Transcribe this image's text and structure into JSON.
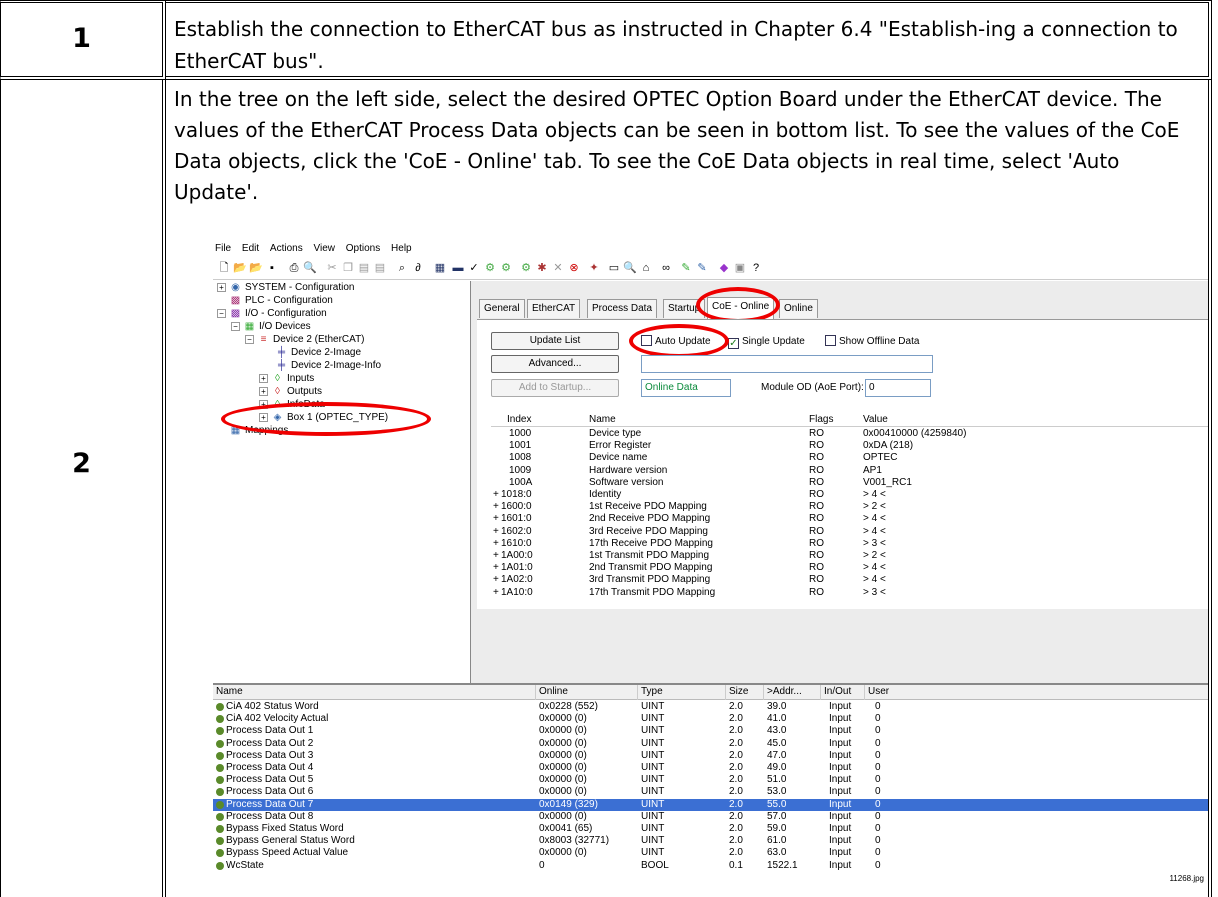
{
  "steps": [
    {
      "number": "1",
      "text": "Establish the connection to EtherCAT bus as instructed in Chapter 6.4 \"Establish-ing a connection to EtherCAT bus\"."
    },
    {
      "number": "2",
      "text": "In the tree on the left side, select the desired OPTEC Option Board under the EtherCAT device. The values of the EtherCAT Process Data objects can be seen in bottom list. To see the values of the CoE Data objects, click the 'CoE - Online' tab. To see the CoE Data objects in real time, select 'Auto Update'."
    }
  ],
  "screenshot": {
    "menu": [
      "File",
      "Edit",
      "Actions",
      "View",
      "Options",
      "Help"
    ],
    "tree": [
      {
        "label": "SYSTEM - Configuration"
      },
      {
        "label": "PLC - Configuration"
      },
      {
        "label": "I/O - Configuration"
      },
      {
        "label": "I/O Devices"
      },
      {
        "label": "Device 2 (EtherCAT)"
      },
      {
        "label": "Device 2-Image"
      },
      {
        "label": "Device 2-Image-Info"
      },
      {
        "label": "Inputs"
      },
      {
        "label": "Outputs"
      },
      {
        "label": "InfoData"
      },
      {
        "label": "Box 1 (OPTEC_TYPE)"
      },
      {
        "label": "Mappings"
      }
    ],
    "tabs": [
      "General",
      "EtherCAT",
      "Process Data",
      "Startup",
      "CoE - Online",
      "Online"
    ],
    "buttons": {
      "update_list": "Update List",
      "advanced": "Advanced...",
      "add_to_startup": "Add to Startup..."
    },
    "checks": {
      "auto_update": "Auto Update",
      "single_update": "Single Update",
      "show_offline": "Show Offline Data"
    },
    "online_data": "Online Data",
    "module_od_label": "Module OD (AoE Port):",
    "module_od_value": "0",
    "coe_headers": [
      "Index",
      "Name",
      "Flags",
      "Value"
    ],
    "coe_rows": [
      {
        "index": "1000",
        "name": "Device type",
        "flags": "RO",
        "value": "0x00410000 (4259840)"
      },
      {
        "index": "1001",
        "name": "Error Register",
        "flags": "RO",
        "value": "0xDA (218)"
      },
      {
        "index": "1008",
        "name": "Device name",
        "flags": "RO",
        "value": "OPTEC"
      },
      {
        "index": "1009",
        "name": "Hardware version",
        "flags": "RO",
        "value": "AP1"
      },
      {
        "index": "100A",
        "name": "Software version",
        "flags": "RO",
        "value": "V001_RC1"
      },
      {
        "index": "1018:0",
        "name": "Identity",
        "flags": "RO",
        "value": "> 4 <"
      },
      {
        "index": "1600:0",
        "name": "1st Receive PDO Mapping",
        "flags": "RO",
        "value": "> 2 <"
      },
      {
        "index": "1601:0",
        "name": "2nd Receive PDO Mapping",
        "flags": "RO",
        "value": "> 4 <"
      },
      {
        "index": "1602:0",
        "name": "3rd Receive PDO Mapping",
        "flags": "RO",
        "value": "> 4 <"
      },
      {
        "index": "1610:0",
        "name": "17th Receive PDO Mapping",
        "flags": "RO",
        "value": "> 3 <"
      },
      {
        "index": "1A00:0",
        "name": "1st Transmit PDO Mapping",
        "flags": "RO",
        "value": "> 2 <"
      },
      {
        "index": "1A01:0",
        "name": "2nd Transmit PDO Mapping",
        "flags": "RO",
        "value": "> 4 <"
      },
      {
        "index": "1A02:0",
        "name": "3rd Transmit PDO Mapping",
        "flags": "RO",
        "value": "> 4 <"
      },
      {
        "index": "1A10:0",
        "name": "17th Transmit PDO Mapping",
        "flags": "RO",
        "value": "> 3 <"
      }
    ],
    "pd_headers": [
      "Name",
      "Online",
      "Type",
      "Size",
      ">Addr...",
      "In/Out",
      "User"
    ],
    "pd_rows": [
      {
        "name": "CiA 402 Status Word",
        "online": "0x0228 (552)",
        "type": "UINT",
        "size": "2.0",
        "addr": "39.0",
        "io": "Input",
        "user": "0"
      },
      {
        "name": "CiA 402 Velocity Actual",
        "online": "0x0000 (0)",
        "type": "UINT",
        "size": "2.0",
        "addr": "41.0",
        "io": "Input",
        "user": "0"
      },
      {
        "name": "Process Data Out 1",
        "online": "0x0000 (0)",
        "type": "UINT",
        "size": "2.0",
        "addr": "43.0",
        "io": "Input",
        "user": "0"
      },
      {
        "name": "Process Data Out 2",
        "online": "0x0000 (0)",
        "type": "UINT",
        "size": "2.0",
        "addr": "45.0",
        "io": "Input",
        "user": "0"
      },
      {
        "name": "Process Data Out 3",
        "online": "0x0000 (0)",
        "type": "UINT",
        "size": "2.0",
        "addr": "47.0",
        "io": "Input",
        "user": "0"
      },
      {
        "name": "Process Data Out 4",
        "online": "0x0000 (0)",
        "type": "UINT",
        "size": "2.0",
        "addr": "49.0",
        "io": "Input",
        "user": "0"
      },
      {
        "name": "Process Data Out 5",
        "online": "0x0000 (0)",
        "type": "UINT",
        "size": "2.0",
        "addr": "51.0",
        "io": "Input",
        "user": "0"
      },
      {
        "name": "Process Data Out 6",
        "online": "0x0000 (0)",
        "type": "UINT",
        "size": "2.0",
        "addr": "53.0",
        "io": "Input",
        "user": "0"
      },
      {
        "name": "Process Data Out 7",
        "online": "0x0149 (329)",
        "type": "UINT",
        "size": "2.0",
        "addr": "55.0",
        "io": "Input",
        "user": "0"
      },
      {
        "name": "Process Data Out 8",
        "online": "0x0000 (0)",
        "type": "UINT",
        "size": "2.0",
        "addr": "57.0",
        "io": "Input",
        "user": "0"
      },
      {
        "name": "Bypass Fixed Status Word",
        "online": "0x0041 (65)",
        "type": "UINT",
        "size": "2.0",
        "addr": "59.0",
        "io": "Input",
        "user": "0"
      },
      {
        "name": "Bypass General Status Word",
        "online": "0x8003 (32771)",
        "type": "UINT",
        "size": "2.0",
        "addr": "61.0",
        "io": "Input",
        "user": "0"
      },
      {
        "name": "Bypass Speed Actual Value",
        "online": "0x0000 (0)",
        "type": "UINT",
        "size": "2.0",
        "addr": "63.0",
        "io": "Input",
        "user": "0"
      },
      {
        "name": "WcState",
        "online": "0",
        "type": "BOOL",
        "size": "0.1",
        "addr": "1522.1",
        "io": "Input",
        "user": "0"
      }
    ],
    "caption": "11268.jpg"
  }
}
